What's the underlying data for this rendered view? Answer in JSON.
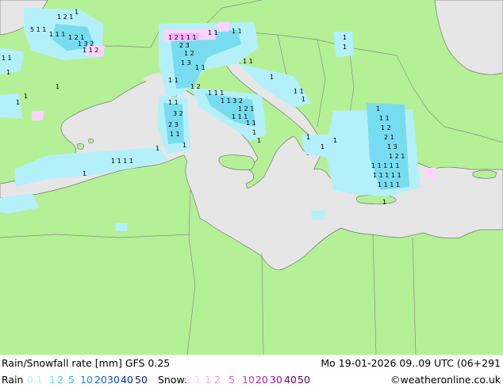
{
  "header": {
    "title": "Rain/Snowfall rate [mm] GFS 0.25",
    "datetime": "Mo 19-01-2026 09..09 UTC (06+291"
  },
  "legend": {
    "rain_label": "Rain",
    "rain_values": [
      {
        "text": "0.1",
        "color": "#b4f0fa"
      },
      {
        "text": "1",
        "color": "#78dcf0"
      },
      {
        "text": "2",
        "color": "#50c8f0"
      },
      {
        "text": "5",
        "color": "#3cb4f0"
      },
      {
        "text": "10",
        "color": "#1e8cf0"
      },
      {
        "text": "20",
        "color": "#1464d2"
      },
      {
        "text": "30",
        "color": "#0a46b4"
      },
      {
        "text": "40",
        "color": "#0a3296"
      },
      {
        "text": "50",
        "color": "#0a1e78"
      }
    ],
    "snow_label": "Snow:",
    "snow_values": [
      {
        "text": "0.1",
        "color": "#ffd2ff"
      },
      {
        "text": "1",
        "color": "#ffaaff"
      },
      {
        "text": "2",
        "color": "#f08cf0"
      },
      {
        "text": "5",
        "color": "#e664e6"
      },
      {
        "text": "10",
        "color": "#d23cd2"
      },
      {
        "text": "20",
        "color": "#b41eb4"
      },
      {
        "text": "30",
        "color": "#960a96"
      },
      {
        "text": "40",
        "color": "#780078"
      },
      {
        "text": "50",
        "color": "#5a005a"
      }
    ],
    "credit": "©weatheronline.co.uk"
  },
  "colors": {
    "land": "#b4f096",
    "sea": "#e6e6e6",
    "rain_light": "#b4f0fa",
    "rain_mid": "#78dcf0",
    "snow_light": "#ffd2ff",
    "border": "#8c8c8c",
    "coast": "#787878"
  }
}
